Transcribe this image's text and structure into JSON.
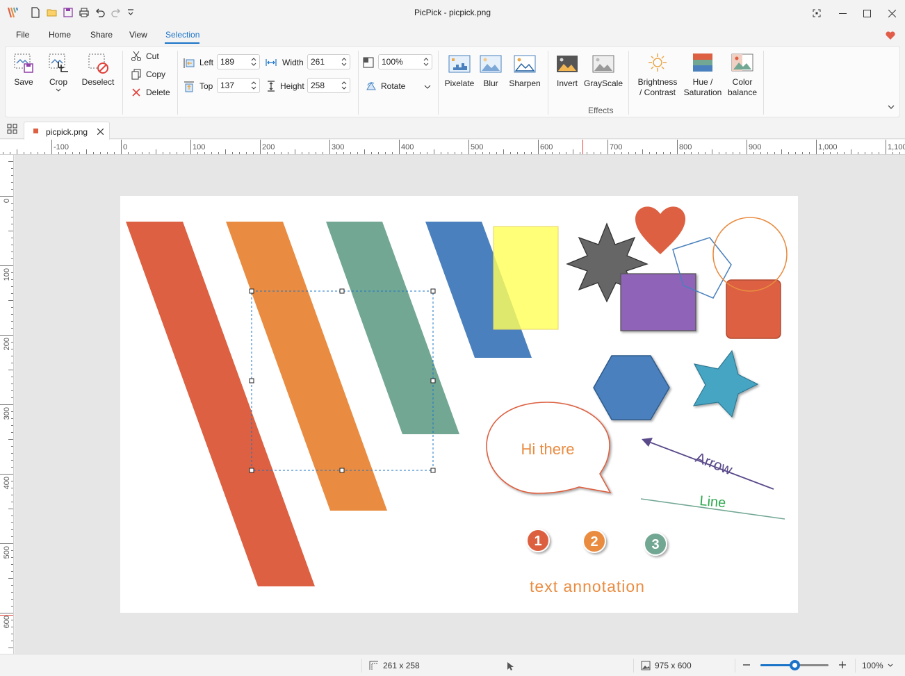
{
  "window": {
    "title": "PicPick - picpick.png"
  },
  "menu": {
    "tabs": [
      "File",
      "Home",
      "Share",
      "View",
      "Selection"
    ],
    "active_tab": "Selection"
  },
  "ribbon": {
    "save": "Save",
    "crop": "Crop",
    "deselect": "Deselect",
    "cut": "Cut",
    "copy": "Copy",
    "delete": "Delete",
    "left_label": "Left",
    "left_value": "189",
    "top_label": "Top",
    "top_value": "137",
    "width_label": "Width",
    "width_value": "261",
    "height_label": "Height",
    "height_value": "258",
    "zoom_value": "100%",
    "rotate": "Rotate",
    "pixelate": "Pixelate",
    "blur": "Blur",
    "sharpen": "Sharpen",
    "invert": "Invert",
    "grayscale": "GrayScale",
    "brightness_line1": "Brightness",
    "brightness_line2": "/ Contrast",
    "hue_line1": "Hue /",
    "hue_line2": "Saturation",
    "color_line1": "Color",
    "color_line2": "balance",
    "effects_group": "Effects"
  },
  "document_tab": {
    "name": "picpick.png"
  },
  "rulers": {
    "horizontal": [
      "-100",
      "0",
      "100",
      "200",
      "300",
      "400",
      "500",
      "600",
      "700",
      "800",
      "900",
      "1,000",
      "1,100"
    ],
    "vertical": [
      "0",
      "100",
      "200",
      "300",
      "400",
      "500",
      "600"
    ]
  },
  "canvas": {
    "speech_text": "Hi there",
    "arrow_text": "Arrow",
    "line_text": "Line",
    "step1": "1",
    "step2": "2",
    "step3": "3",
    "annotation": "text annotation",
    "colors": {
      "red": "#dc6041",
      "orange": "#e98c41",
      "teal": "#72a793",
      "blue": "#4a80bd",
      "yellow": "#ffff5a",
      "purple": "#8f63b8",
      "gray": "#666666"
    }
  },
  "status": {
    "selection_size": "261 x 258",
    "image_size": "975 x 600",
    "zoom": "100%",
    "zoom_level": 0.5
  },
  "accent_color": "#1a73c8"
}
